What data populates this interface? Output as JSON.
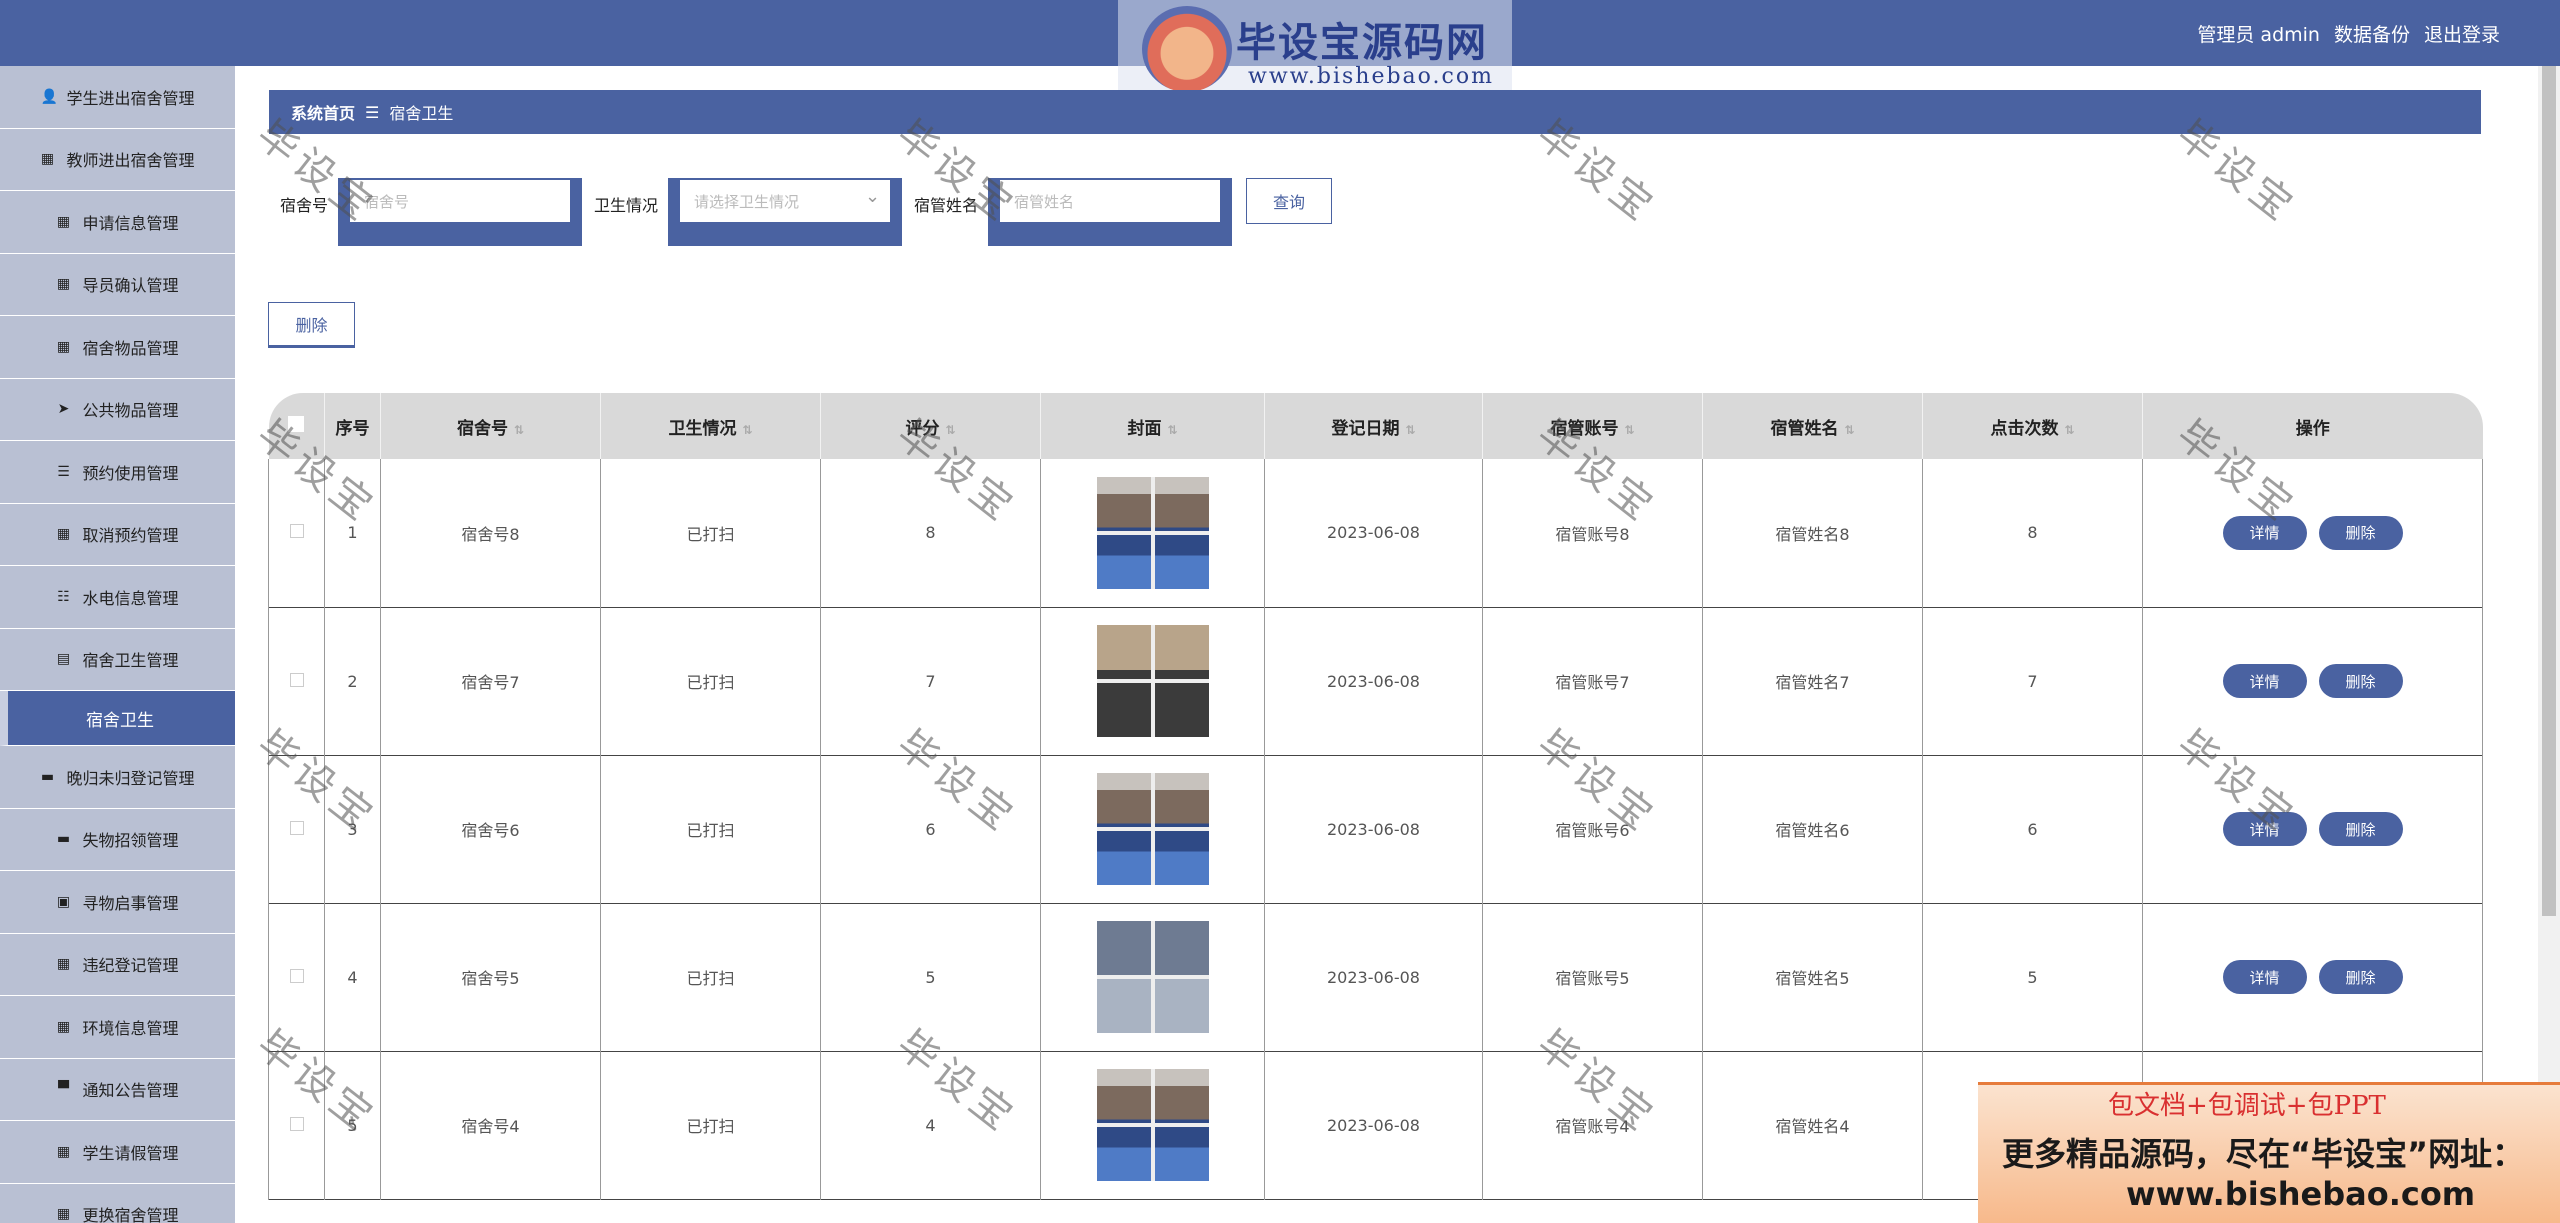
{
  "header": {
    "user_label": "管理员 admin",
    "backup_link": "数据备份",
    "logout_link": "退出登录",
    "logo_brand": "毕设宝源码网",
    "logo_url": "www.bishebao.com"
  },
  "sidebar": {
    "items": [
      {
        "label": "学生进出宿舍管理",
        "icon": "user-icon"
      },
      {
        "label": "教师进出宿舍管理",
        "icon": "grid-icon"
      },
      {
        "label": "申请信息管理",
        "icon": "apps-icon"
      },
      {
        "label": "导员确认管理",
        "icon": "grid-icon"
      },
      {
        "label": "宿舍物品管理",
        "icon": "grid-icon"
      },
      {
        "label": "公共物品管理",
        "icon": "send-icon"
      },
      {
        "label": "预约使用管理",
        "icon": "list-icon"
      },
      {
        "label": "取消预约管理",
        "icon": "grid-icon"
      },
      {
        "label": "水电信息管理",
        "icon": "sliders-icon"
      },
      {
        "label": "宿舍卫生管理",
        "icon": "clipboard-icon"
      }
    ],
    "active_sub": "宿舍卫生",
    "items_after": [
      {
        "label": "晚归未归登记管理",
        "icon": "chat-icon"
      },
      {
        "label": "失物招领管理",
        "icon": "card-icon"
      },
      {
        "label": "寻物启事管理",
        "icon": "clipboard-x-icon"
      },
      {
        "label": "违纪登记管理",
        "icon": "grid-icon"
      },
      {
        "label": "环境信息管理",
        "icon": "grid-icon"
      },
      {
        "label": "通知公告管理",
        "icon": "monitor-icon"
      },
      {
        "label": "学生请假管理",
        "icon": "grid-icon"
      },
      {
        "label": "更换宿舍管理",
        "icon": "grid-icon"
      }
    ]
  },
  "breadcrumb": {
    "home": "系统首页",
    "separator": "☰",
    "current": "宿舍卫生"
  },
  "search": {
    "dorm_label": "宿舍号",
    "dorm_placeholder": "宿舍号",
    "hygiene_label": "卫生情况",
    "hygiene_placeholder": "请选择卫生情况",
    "manager_label": "宿管姓名",
    "manager_placeholder": "宿管姓名",
    "query_button": "查询"
  },
  "delete_button": "删除",
  "table": {
    "headers": [
      "序号",
      "宿舍号",
      "卫生情况",
      "评分",
      "封面",
      "登记日期",
      "宿管账号",
      "宿管姓名",
      "点击次数",
      "操作"
    ],
    "detail_label": "详情",
    "delete_label": "删除",
    "rows": [
      {
        "idx": "1",
        "dorm": "宿舍号8",
        "hygiene": "已打扫",
        "score": "8",
        "date": "2023-06-08",
        "account": "宿管账号8",
        "name": "宿管姓名8",
        "clicks": "8"
      },
      {
        "idx": "2",
        "dorm": "宿舍号7",
        "hygiene": "已打扫",
        "score": "7",
        "date": "2023-06-08",
        "account": "宿管账号7",
        "name": "宿管姓名7",
        "clicks": "7"
      },
      {
        "idx": "3",
        "dorm": "宿舍号6",
        "hygiene": "已打扫",
        "score": "6",
        "date": "2023-06-08",
        "account": "宿管账号6",
        "name": "宿管姓名6",
        "clicks": "6"
      },
      {
        "idx": "4",
        "dorm": "宿舍号5",
        "hygiene": "已打扫",
        "score": "5",
        "date": "2023-06-08",
        "account": "宿管账号5",
        "name": "宿管姓名5",
        "clicks": "5"
      },
      {
        "idx": "5",
        "dorm": "宿舍号4",
        "hygiene": "已打扫",
        "score": "4",
        "date": "2023-06-08",
        "account": "宿管账号4",
        "name": "宿管姓名4",
        "clicks": ""
      }
    ]
  },
  "watermark": "毕设宝",
  "promo": {
    "line1": "包文档+包调试+包PPT",
    "line2": "更多精品源码，尽在“毕设宝”网址：",
    "line3": "www.bishebao.com"
  }
}
